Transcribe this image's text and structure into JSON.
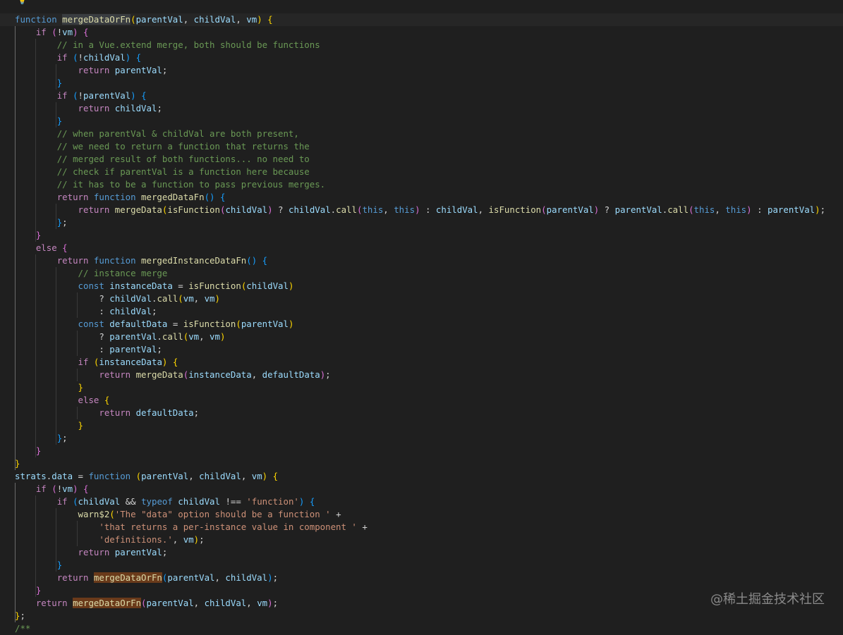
{
  "editor": {
    "theme_colors": {
      "background": "#1f1f1f",
      "keyword": "#569cd6",
      "control": "#c586c0",
      "function": "#dcdcaa",
      "variable": "#9cdcfe",
      "string": "#ce9178",
      "comment": "#6a9955",
      "bracket_level_1": "#ffd700",
      "bracket_level_2": "#da70d6",
      "bracket_level_3": "#179fff"
    },
    "lightbulb_icon": "lightbulb-icon",
    "code_lines": [
      [
        [
          "pun",
          "  "
        ]
      ],
      [
        [
          "kw",
          "function "
        ],
        [
          "fn sel",
          "mergeDataOrFn"
        ],
        [
          "b1",
          "("
        ],
        [
          "var",
          "parentVal"
        ],
        [
          "pun",
          ", "
        ],
        [
          "var",
          "childVal"
        ],
        [
          "pun",
          ", "
        ],
        [
          "var",
          "vm"
        ],
        [
          "b1",
          ")"
        ],
        [
          "pun",
          " "
        ],
        [
          "b1",
          "{"
        ]
      ],
      [
        [
          "pun",
          "    "
        ],
        [
          "ctl",
          "if "
        ],
        [
          "b2",
          "("
        ],
        [
          "pun",
          "!"
        ],
        [
          "var",
          "vm"
        ],
        [
          "b2",
          ")"
        ],
        [
          "pun",
          " "
        ],
        [
          "b2",
          "{"
        ]
      ],
      [
        [
          "pun",
          "        "
        ],
        [
          "cmt",
          "// in a Vue.extend merge, both should be functions"
        ]
      ],
      [
        [
          "pun",
          "        "
        ],
        [
          "ctl",
          "if "
        ],
        [
          "b3",
          "("
        ],
        [
          "pun",
          "!"
        ],
        [
          "var",
          "childVal"
        ],
        [
          "b3",
          ")"
        ],
        [
          "pun",
          " "
        ],
        [
          "b3",
          "{"
        ]
      ],
      [
        [
          "pun",
          "            "
        ],
        [
          "ctl",
          "return "
        ],
        [
          "var",
          "parentVal"
        ],
        [
          "pun",
          ";"
        ]
      ],
      [
        [
          "pun",
          "        "
        ],
        [
          "b3",
          "}"
        ]
      ],
      [
        [
          "pun",
          "        "
        ],
        [
          "ctl",
          "if "
        ],
        [
          "b3",
          "("
        ],
        [
          "pun",
          "!"
        ],
        [
          "var",
          "parentVal"
        ],
        [
          "b3",
          ")"
        ],
        [
          "pun",
          " "
        ],
        [
          "b3",
          "{"
        ]
      ],
      [
        [
          "pun",
          "            "
        ],
        [
          "ctl",
          "return "
        ],
        [
          "var",
          "childVal"
        ],
        [
          "pun",
          ";"
        ]
      ],
      [
        [
          "pun",
          "        "
        ],
        [
          "b3",
          "}"
        ]
      ],
      [
        [
          "pun",
          "        "
        ],
        [
          "cmt",
          "// when parentVal & childVal are both present,"
        ]
      ],
      [
        [
          "pun",
          "        "
        ],
        [
          "cmt",
          "// we need to return a function that returns the"
        ]
      ],
      [
        [
          "pun",
          "        "
        ],
        [
          "cmt",
          "// merged result of both functions... no need to"
        ]
      ],
      [
        [
          "pun",
          "        "
        ],
        [
          "cmt",
          "// check if parentVal is a function here because"
        ]
      ],
      [
        [
          "pun",
          "        "
        ],
        [
          "cmt",
          "// it has to be a function to pass previous merges."
        ]
      ],
      [
        [
          "pun",
          "        "
        ],
        [
          "ctl",
          "return "
        ],
        [
          "kw",
          "function "
        ],
        [
          "fn",
          "mergedDataFn"
        ],
        [
          "b3",
          "()"
        ],
        [
          "pun",
          " "
        ],
        [
          "b3",
          "{"
        ]
      ],
      [
        [
          "pun",
          "            "
        ],
        [
          "ctl",
          "return "
        ],
        [
          "fn",
          "mergeData"
        ],
        [
          "b1",
          "("
        ],
        [
          "fn",
          "isFunction"
        ],
        [
          "b2",
          "("
        ],
        [
          "var",
          "childVal"
        ],
        [
          "b2",
          ")"
        ],
        [
          "pun",
          " ? "
        ],
        [
          "var",
          "childVal"
        ],
        [
          "pun",
          "."
        ],
        [
          "fn",
          "call"
        ],
        [
          "b2",
          "("
        ],
        [
          "kw",
          "this"
        ],
        [
          "pun",
          ", "
        ],
        [
          "kw",
          "this"
        ],
        [
          "b2",
          ")"
        ],
        [
          "pun",
          " : "
        ],
        [
          "var",
          "childVal"
        ],
        [
          "pun",
          ", "
        ],
        [
          "fn",
          "isFunction"
        ],
        [
          "b2",
          "("
        ],
        [
          "var",
          "parentVal"
        ],
        [
          "b2",
          ")"
        ],
        [
          "pun",
          " ? "
        ],
        [
          "var",
          "parentVal"
        ],
        [
          "pun",
          "."
        ],
        [
          "fn",
          "call"
        ],
        [
          "b2",
          "("
        ],
        [
          "kw",
          "this"
        ],
        [
          "pun",
          ", "
        ],
        [
          "kw",
          "this"
        ],
        [
          "b2",
          ")"
        ],
        [
          "pun",
          " : "
        ],
        [
          "var",
          "parentVal"
        ],
        [
          "b1",
          ")"
        ],
        [
          "pun",
          ";"
        ]
      ],
      [
        [
          "pun",
          "        "
        ],
        [
          "b3",
          "}"
        ],
        [
          "pun",
          ";"
        ]
      ],
      [
        [
          "pun",
          "    "
        ],
        [
          "b2",
          "}"
        ]
      ],
      [
        [
          "pun",
          "    "
        ],
        [
          "ctl",
          "else "
        ],
        [
          "b2",
          "{"
        ]
      ],
      [
        [
          "pun",
          "        "
        ],
        [
          "ctl",
          "return "
        ],
        [
          "kw",
          "function "
        ],
        [
          "fn",
          "mergedInstanceDataFn"
        ],
        [
          "b3",
          "()"
        ],
        [
          "pun",
          " "
        ],
        [
          "b3",
          "{"
        ]
      ],
      [
        [
          "pun",
          "            "
        ],
        [
          "cmt",
          "// instance merge"
        ]
      ],
      [
        [
          "pun",
          "            "
        ],
        [
          "kw",
          "const "
        ],
        [
          "var",
          "instanceData"
        ],
        [
          "pun",
          " = "
        ],
        [
          "fn",
          "isFunction"
        ],
        [
          "b1",
          "("
        ],
        [
          "var",
          "childVal"
        ],
        [
          "b1",
          ")"
        ]
      ],
      [
        [
          "pun",
          "                ? "
        ],
        [
          "var",
          "childVal"
        ],
        [
          "pun",
          "."
        ],
        [
          "fn",
          "call"
        ],
        [
          "b1",
          "("
        ],
        [
          "var",
          "vm"
        ],
        [
          "pun",
          ", "
        ],
        [
          "var",
          "vm"
        ],
        [
          "b1",
          ")"
        ]
      ],
      [
        [
          "pun",
          "                : "
        ],
        [
          "var",
          "childVal"
        ],
        [
          "pun",
          ";"
        ]
      ],
      [
        [
          "pun",
          "            "
        ],
        [
          "kw",
          "const "
        ],
        [
          "var",
          "defaultData"
        ],
        [
          "pun",
          " = "
        ],
        [
          "fn",
          "isFunction"
        ],
        [
          "b1",
          "("
        ],
        [
          "var",
          "parentVal"
        ],
        [
          "b1",
          ")"
        ]
      ],
      [
        [
          "pun",
          "                ? "
        ],
        [
          "var",
          "parentVal"
        ],
        [
          "pun",
          "."
        ],
        [
          "fn",
          "call"
        ],
        [
          "b1",
          "("
        ],
        [
          "var",
          "vm"
        ],
        [
          "pun",
          ", "
        ],
        [
          "var",
          "vm"
        ],
        [
          "b1",
          ")"
        ]
      ],
      [
        [
          "pun",
          "                : "
        ],
        [
          "var",
          "parentVal"
        ],
        [
          "pun",
          ";"
        ]
      ],
      [
        [
          "pun",
          "            "
        ],
        [
          "ctl",
          "if "
        ],
        [
          "b1",
          "("
        ],
        [
          "var",
          "instanceData"
        ],
        [
          "b1",
          ")"
        ],
        [
          "pun",
          " "
        ],
        [
          "b1",
          "{"
        ]
      ],
      [
        [
          "pun",
          "                "
        ],
        [
          "ctl",
          "return "
        ],
        [
          "fn",
          "mergeData"
        ],
        [
          "b2",
          "("
        ],
        [
          "var",
          "instanceData"
        ],
        [
          "pun",
          ", "
        ],
        [
          "var",
          "defaultData"
        ],
        [
          "b2",
          ")"
        ],
        [
          "pun",
          ";"
        ]
      ],
      [
        [
          "pun",
          "            "
        ],
        [
          "b1",
          "}"
        ]
      ],
      [
        [
          "pun",
          "            "
        ],
        [
          "ctl",
          "else "
        ],
        [
          "b1",
          "{"
        ]
      ],
      [
        [
          "pun",
          "                "
        ],
        [
          "ctl",
          "return "
        ],
        [
          "var",
          "defaultData"
        ],
        [
          "pun",
          ";"
        ]
      ],
      [
        [
          "pun",
          "            "
        ],
        [
          "b1",
          "}"
        ]
      ],
      [
        [
          "pun",
          "        "
        ],
        [
          "b3",
          "}"
        ],
        [
          "pun",
          ";"
        ]
      ],
      [
        [
          "pun",
          "    "
        ],
        [
          "b2",
          "}"
        ]
      ],
      [
        [
          "b1",
          "}"
        ]
      ],
      [
        [
          "var",
          "strats"
        ],
        [
          "pun",
          "."
        ],
        [
          "var",
          "data"
        ],
        [
          "pun",
          " = "
        ],
        [
          "kw",
          "function "
        ],
        [
          "b1",
          "("
        ],
        [
          "var",
          "parentVal"
        ],
        [
          "pun",
          ", "
        ],
        [
          "var",
          "childVal"
        ],
        [
          "pun",
          ", "
        ],
        [
          "var",
          "vm"
        ],
        [
          "b1",
          ")"
        ],
        [
          "pun",
          " "
        ],
        [
          "b1",
          "{"
        ]
      ],
      [
        [
          "pun",
          "    "
        ],
        [
          "ctl",
          "if "
        ],
        [
          "b2",
          "("
        ],
        [
          "pun",
          "!"
        ],
        [
          "var",
          "vm"
        ],
        [
          "b2",
          ")"
        ],
        [
          "pun",
          " "
        ],
        [
          "b2",
          "{"
        ]
      ],
      [
        [
          "pun",
          "        "
        ],
        [
          "ctl",
          "if "
        ],
        [
          "b3",
          "("
        ],
        [
          "var",
          "childVal"
        ],
        [
          "pun",
          " && "
        ],
        [
          "kw",
          "typeof "
        ],
        [
          "var",
          "childVal"
        ],
        [
          "pun",
          " !== "
        ],
        [
          "str",
          "'function'"
        ],
        [
          "b3",
          ")"
        ],
        [
          "pun",
          " "
        ],
        [
          "b3",
          "{"
        ]
      ],
      [
        [
          "pun",
          "            "
        ],
        [
          "fn",
          "warn$2"
        ],
        [
          "b1",
          "("
        ],
        [
          "str",
          "'The \"data\" option should be a function '"
        ],
        [
          "pun",
          " +"
        ]
      ],
      [
        [
          "pun",
          "                "
        ],
        [
          "str",
          "'that returns a per-instance value in component '"
        ],
        [
          "pun",
          " +"
        ]
      ],
      [
        [
          "pun",
          "                "
        ],
        [
          "str",
          "'definitions.'"
        ],
        [
          "pun",
          ", "
        ],
        [
          "var",
          "vm"
        ],
        [
          "b1",
          ")"
        ],
        [
          "pun",
          ";"
        ]
      ],
      [
        [
          "pun",
          "            "
        ],
        [
          "ctl",
          "return "
        ],
        [
          "var",
          "parentVal"
        ],
        [
          "pun",
          ";"
        ]
      ],
      [
        [
          "pun",
          "        "
        ],
        [
          "b3",
          "}"
        ]
      ],
      [
        [
          "pun",
          "        "
        ],
        [
          "ctl",
          "return "
        ],
        [
          "fn hl",
          "mergeDataOrFn"
        ],
        [
          "b3",
          "("
        ],
        [
          "var",
          "parentVal"
        ],
        [
          "pun",
          ", "
        ],
        [
          "var",
          "childVal"
        ],
        [
          "b3",
          ")"
        ],
        [
          "pun",
          ";"
        ]
      ],
      [
        [
          "pun",
          "    "
        ],
        [
          "b2",
          "}"
        ]
      ],
      [
        [
          "pun",
          "    "
        ],
        [
          "ctl",
          "return "
        ],
        [
          "fn hl",
          "mergeDataOrFn"
        ],
        [
          "b2",
          "("
        ],
        [
          "var",
          "parentVal"
        ],
        [
          "pun",
          ", "
        ],
        [
          "var",
          "childVal"
        ],
        [
          "pun",
          ", "
        ],
        [
          "var",
          "vm"
        ],
        [
          "b2",
          ")"
        ],
        [
          "pun",
          ";"
        ]
      ],
      [
        [
          "b1",
          "}"
        ],
        [
          "pun",
          ";"
        ]
      ],
      [
        [
          "cmt",
          "/**"
        ]
      ]
    ]
  },
  "watermark": {
    "text": "@稀土掘金技术社区"
  }
}
